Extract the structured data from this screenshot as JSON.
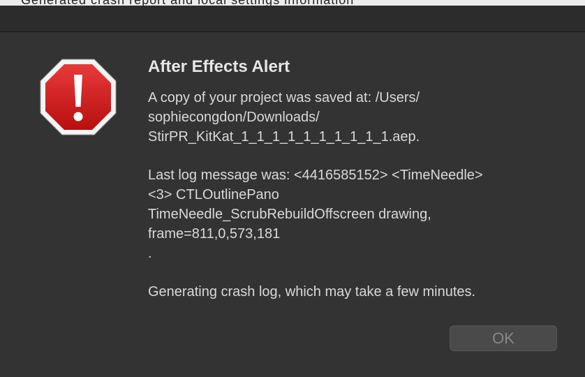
{
  "background_text": "Generated crash report and local settings information",
  "alert": {
    "title": "After Effects Alert",
    "icon": "stop-sign-exclamation-icon",
    "message_lines_1": [
      "A copy of your project was saved at: /Users/",
      "sophiecongdon/Downloads/",
      "StirPR_KitKat_1_1_1_1_1_1_1_1_1_1.aep."
    ],
    "message_lines_2": [
      "Last log message was: <4416585152> <TimeNeedle>",
      "<3> CTLOutlinePano",
      "TimeNeedle_ScrubRebuildOffscreen drawing,",
      "frame=811,0,573,181",
      "."
    ],
    "message_lines_3": [
      "Generating crash log, which may take a few minutes."
    ],
    "ok_label": "OK"
  },
  "colors": {
    "dialog_bg": "#333333",
    "icon_red": "#d11a1a",
    "icon_border": "#ffffff",
    "button_text_disabled": "#888888"
  }
}
